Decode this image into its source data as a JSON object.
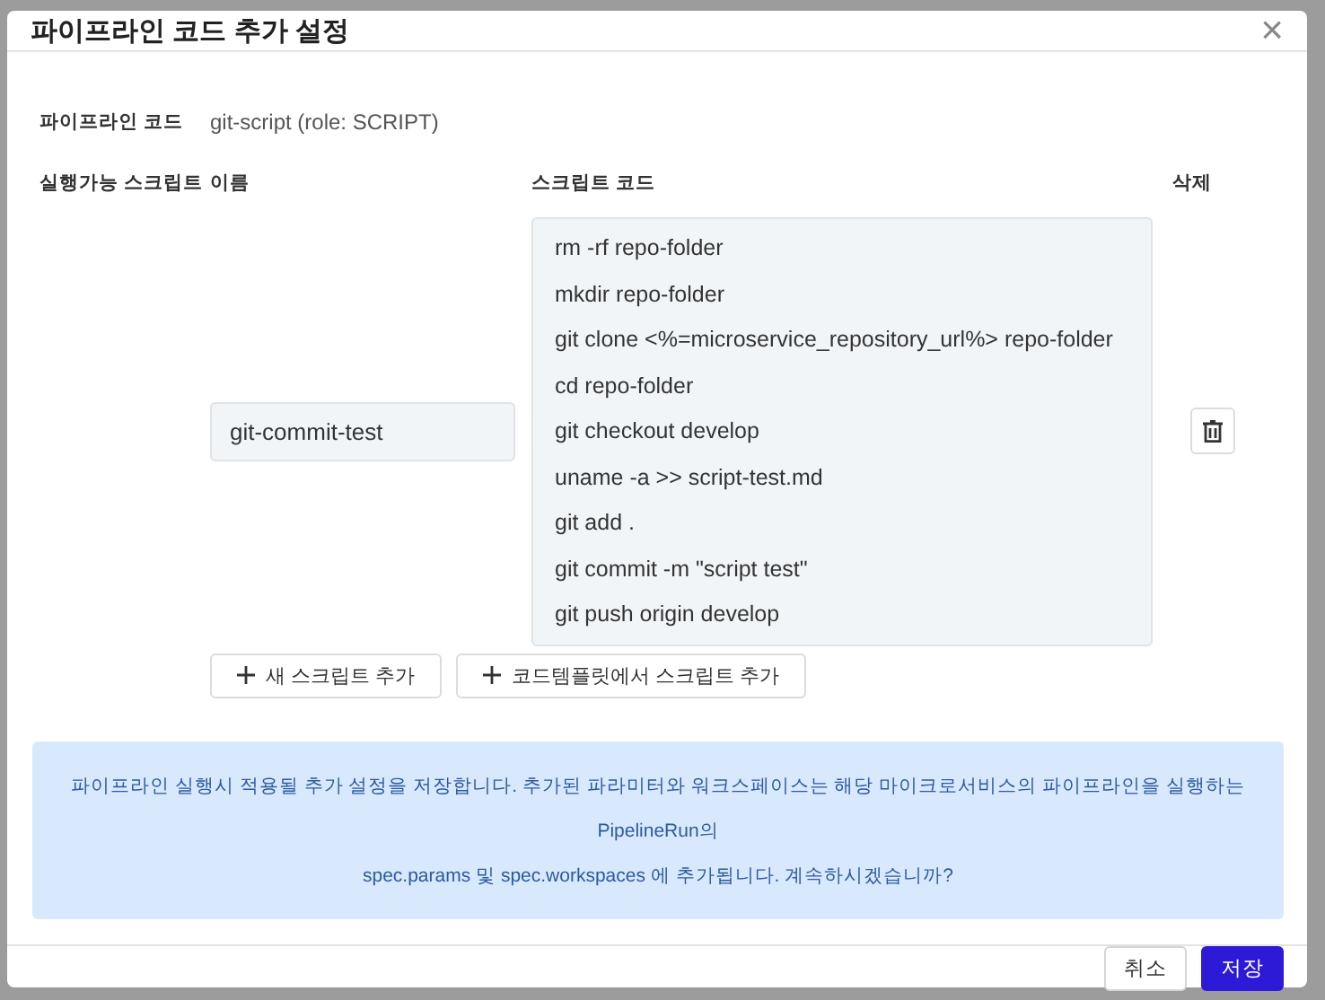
{
  "dialog": {
    "title": "파이프라인 코드 추가 설정",
    "close_icon": "×"
  },
  "pipeline_code": {
    "label": "파이프라인 코드",
    "value": "git-script (role: SCRIPT)"
  },
  "scripts": {
    "label": "실행가능 스크립트",
    "columns": [
      "이름",
      "스크립트 코드",
      "삭제"
    ],
    "rows": [
      {
        "name": "git-commit-test",
        "code": [
          "rm -rf repo-folder",
          "mkdir repo-folder",
          "git clone <%=microservice_repository_url%> repo-folder",
          "cd repo-folder",
          "git checkout develop",
          "uname -a >> script-test.md",
          "git add .",
          "git commit -m \"script test\"",
          "git push origin develop"
        ]
      }
    ],
    "add_buttons": [
      "새 스크립트 추가",
      "코드템플릿에서 스크립트 추가"
    ]
  },
  "notice": {
    "lines": [
      "파이프라인 실행시 적용될 추가 설정을 저장합니다. 추가된 파라미터와 워크스페이스는 해당 마이크로서비스의 파이프라인을 실행하는 PipelineRun의",
      "spec.params 및 spec.workspaces 에 추가됩니다. 계속하시겠습니까?"
    ]
  },
  "footer": {
    "buttons": [
      {
        "label": "취소",
        "kind": "secondary"
      },
      {
        "label": "저장",
        "kind": "primary"
      }
    ]
  }
}
